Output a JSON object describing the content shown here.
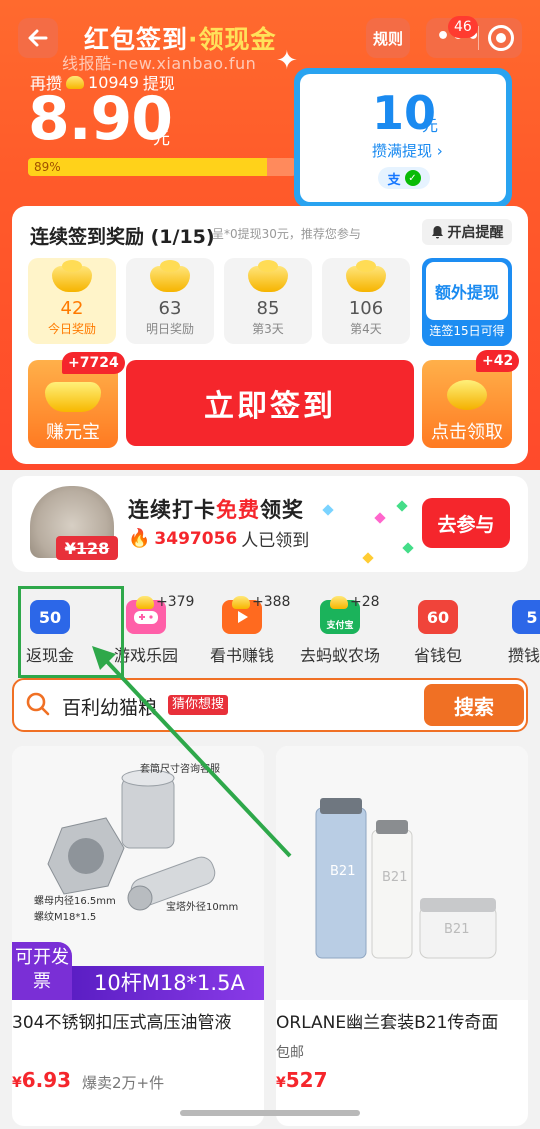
{
  "header": {
    "title_prefix": "红包签到",
    "title_dot": "·",
    "title_suffix": "领现金",
    "rule_label": "规则",
    "notification_count": "46",
    "watermark": "线报酷-new.xianbao.fun"
  },
  "balance": {
    "need_prefix": "再攒",
    "need_coins": "10949",
    "need_suffix": "提现",
    "amount": "8.90",
    "unit": "元",
    "progress_text": "89%",
    "progress_fraction": 0.89
  },
  "withdraw": {
    "amount": "10",
    "unit": "元",
    "label": "攒满提现 ›",
    "alipay_icon": "支",
    "wechat_icon": "✓"
  },
  "sign": {
    "title": "连续签到奖励 (1/15)",
    "subtitle": "呈*0提现30元，推荐您参与",
    "remind_label": "开启提醒",
    "days": [
      {
        "value": "42",
        "label": "今日奖励"
      },
      {
        "value": "63",
        "label": "明日奖励"
      },
      {
        "value": "85",
        "label": "第3天"
      },
      {
        "value": "106",
        "label": "第4天"
      }
    ],
    "extra_title": "额外提现",
    "extra_sub": "连签15日可得",
    "earn_tag": "+7724",
    "earn_label": "赚元宝",
    "sign_button": "立即签到",
    "claim_tag": "+42",
    "claim_label": "点击领取"
  },
  "promo": {
    "price": "¥128",
    "title_a": "连续打卡",
    "title_hl": "免费",
    "title_b": "领奖",
    "count": "3497056",
    "count_suffix": "人已领到",
    "button": "去参与"
  },
  "shortcuts": [
    {
      "label": "返现金",
      "icon_text": "50",
      "plus": ""
    },
    {
      "label": "游戏乐园",
      "icon_text": "",
      "plus": "+379"
    },
    {
      "label": "看书赚钱",
      "icon_text": "",
      "plus": "+388"
    },
    {
      "label": "去蚂蚁农场",
      "icon_text": "支付宝",
      "plus": "+28"
    },
    {
      "label": "省钱包",
      "icon_text": "60",
      "plus": ""
    },
    {
      "label": "攒钱挑",
      "icon_text": "5",
      "plus": ""
    }
  ],
  "search": {
    "query": "百利幼猫粮",
    "guess_tag": "猜你想搜",
    "button": "搜索"
  },
  "products": [
    {
      "name": "304不锈钢扣压式高压油管液",
      "price_currency": "¥",
      "price": "6.93",
      "sales": "爆卖2万+件",
      "invoice": "可开发票",
      "spec": "10杆M18*1.5A",
      "labels": [
        "套筒尺寸咨询客服",
        "螺母内径16.5mm",
        "螺纹M18*1.5",
        "宝塔外径10mm"
      ]
    },
    {
      "name": "ORLANE幽兰套装B21传奇面",
      "shipping": "包邮",
      "price_currency": "¥",
      "price": "527",
      "brand_text": "B21"
    }
  ],
  "colors": {
    "header_red": "#ff5a2a",
    "accent_red": "#f5262c",
    "blue": "#1a8af0",
    "gold": "#ffe15a",
    "highlight_green": "#2ea84a"
  }
}
